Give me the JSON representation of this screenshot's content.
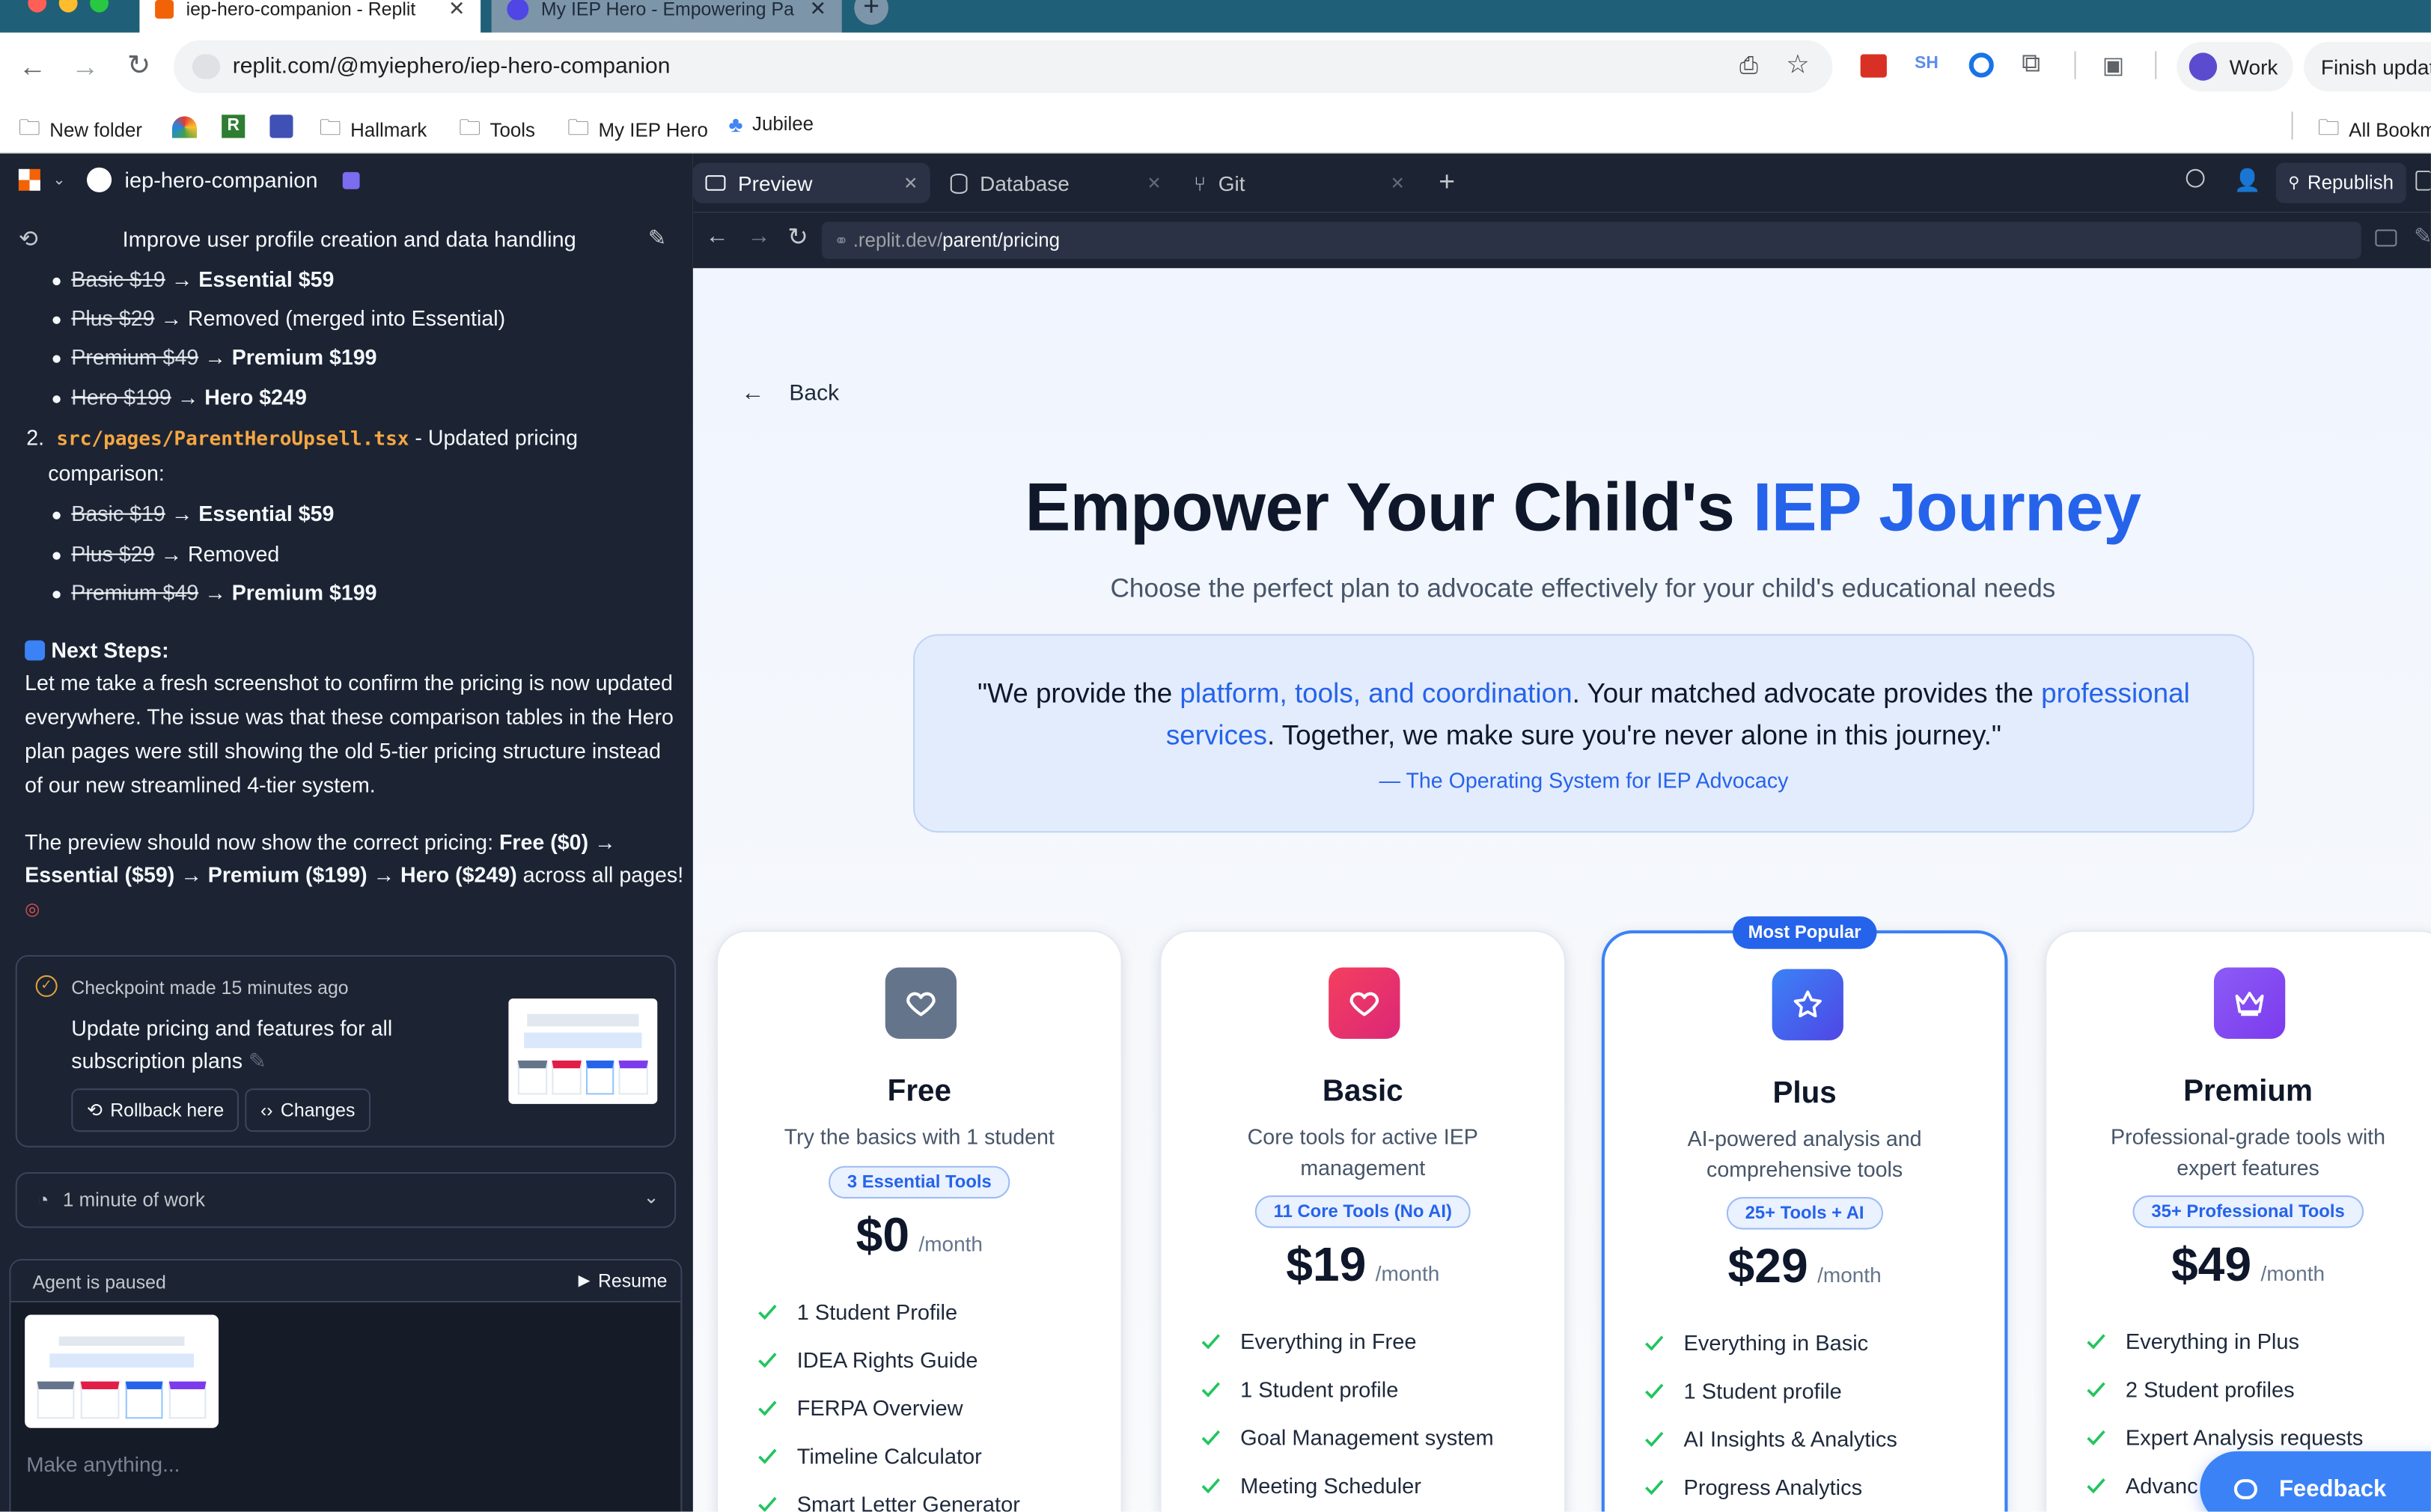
{
  "browser": {
    "tabs": [
      {
        "title": "iep-hero-companion - Replit",
        "active": true
      },
      {
        "title": "My IEP Hero - Empowering Pa",
        "active": false
      }
    ],
    "url": "replit.com/@myiephero/iep-hero-companion",
    "profile_label": "Work",
    "update_label": "Finish updat",
    "sh_label": "SH",
    "bookmarks": [
      "New folder",
      "Hallmark",
      "Tools",
      "My IEP Hero",
      "Jubilee"
    ],
    "all_bookmarks": "All Bookm"
  },
  "workspace": {
    "project_name": "iep-hero-companion",
    "tabs": [
      "Preview",
      "Database",
      "Git"
    ],
    "republish_label": "Republish",
    "preview_url_prefix": ".replit.dev/",
    "preview_url_path": "parent/pricing"
  },
  "agent": {
    "thread_title": "Improve user profile creation and data handling",
    "list1": [
      {
        "old": "Basic $19",
        "arrow": " → ",
        "new": "Essential $59",
        "bold": true
      },
      {
        "old": "Plus $29",
        "arrow": " → ",
        "new": "Removed (merged into Essential)",
        "bold": false
      },
      {
        "old": "Premium $49",
        "arrow": " → ",
        "new": "Premium $199",
        "bold": true
      },
      {
        "old": "Hero $199",
        "arrow": " → ",
        "new": "Hero $249",
        "bold": true
      }
    ],
    "item2_num": "2.",
    "item2_code": "src/pages/ParentHeroUpsell.tsx",
    "item2_rest": " - Updated pricing",
    "item2_cont": "comparison:",
    "list2": [
      {
        "old": "Basic $19",
        "arrow": " → ",
        "new": "Essential $59",
        "bold": true
      },
      {
        "old": "Plus $29",
        "arrow": " → ",
        "new": "Removed",
        "bold": false
      },
      {
        "old": "Premium $49",
        "arrow": " → ",
        "new": "Premium $199",
        "bold": true
      }
    ],
    "next_steps_title": "Next Steps:",
    "para1": [
      "Let me take a fresh screenshot to confirm the pricing is now updated",
      "everywhere. The issue was that these comparison tables in the Hero",
      "plan pages were still showing the old 5-tier pricing structure instead",
      "of our new streamlined 4-tier system."
    ],
    "para2_a": "The preview should now show the correct pricing: ",
    "para2_b": "Free ($0) →",
    "para2_c": "Essential ($59) → Premium ($199) → Hero ($249)",
    "para2_d": " across all pages!",
    "checkpoint": {
      "label": "Checkpoint made",
      "time": "15 minutes ago",
      "title_l1": "Update pricing and features for all",
      "title_l2": "subscription plans",
      "rollback": "Rollback here",
      "changes": "Changes"
    },
    "work_label": "1 minute of work",
    "paused_label": "Agent is paused",
    "resume_label": "Resume",
    "input_placeholder": "Make anything..."
  },
  "page": {
    "back_label": "Back",
    "heading_main": "Empower Your Child's ",
    "heading_accent": "IEP Journey",
    "subtitle": "Choose the perfect plan to advocate effectively for your child's educational needs",
    "quote": {
      "p1": "\"We provide the ",
      "h1": "platform, tools, and coordination",
      "p2": ". Your matched advocate provides the ",
      "h2a": "professional",
      "h2b": "services",
      "p3": ". Together, we make sure you're never alone in this journey.\"",
      "attribution": "— The Operating System for IEP Advocacy"
    },
    "most_popular": "Most Popular",
    "feedback_label": "Feedback",
    "plans": [
      {
        "name": "Free",
        "desc": [
          "Try the basics with 1 student"
        ],
        "badge": "3 Essential Tools",
        "price": "$0",
        "period": "/month",
        "features": [
          "1 Student Profile",
          "IDEA Rights Guide",
          "FERPA Overview",
          "Timeline Calculator",
          "Smart Letter Generator"
        ],
        "icon_color": "#64748b"
      },
      {
        "name": "Basic",
        "desc": [
          "Core tools for active IEP",
          "management"
        ],
        "badge": "11 Core Tools (No AI)",
        "price": "$19",
        "period": "/month",
        "features": [
          "Everything in Free",
          "1 Student profile",
          "Goal Management system",
          "Meeting Scheduler"
        ],
        "icon_color": "#e11d48"
      },
      {
        "name": "Plus",
        "desc": [
          "AI-powered analysis and",
          "comprehensive tools"
        ],
        "badge": "25+ Tools + AI",
        "price": "$29",
        "period": "/month",
        "features": [
          "Everything in Basic",
          "1 Student profile",
          "AI Insights & Analytics",
          "Progress Analytics"
        ],
        "icon_color": "#2563eb"
      },
      {
        "name": "Premium",
        "desc": [
          "Professional-grade tools with",
          "expert features"
        ],
        "badge": "35+ Professional Tools",
        "price": "$49",
        "period": "/month",
        "features": [
          "Everything in Plus",
          "2 Student profiles",
          "Expert Analysis requests",
          "Advanc"
        ],
        "icon_color": "#7c3aed"
      }
    ]
  }
}
